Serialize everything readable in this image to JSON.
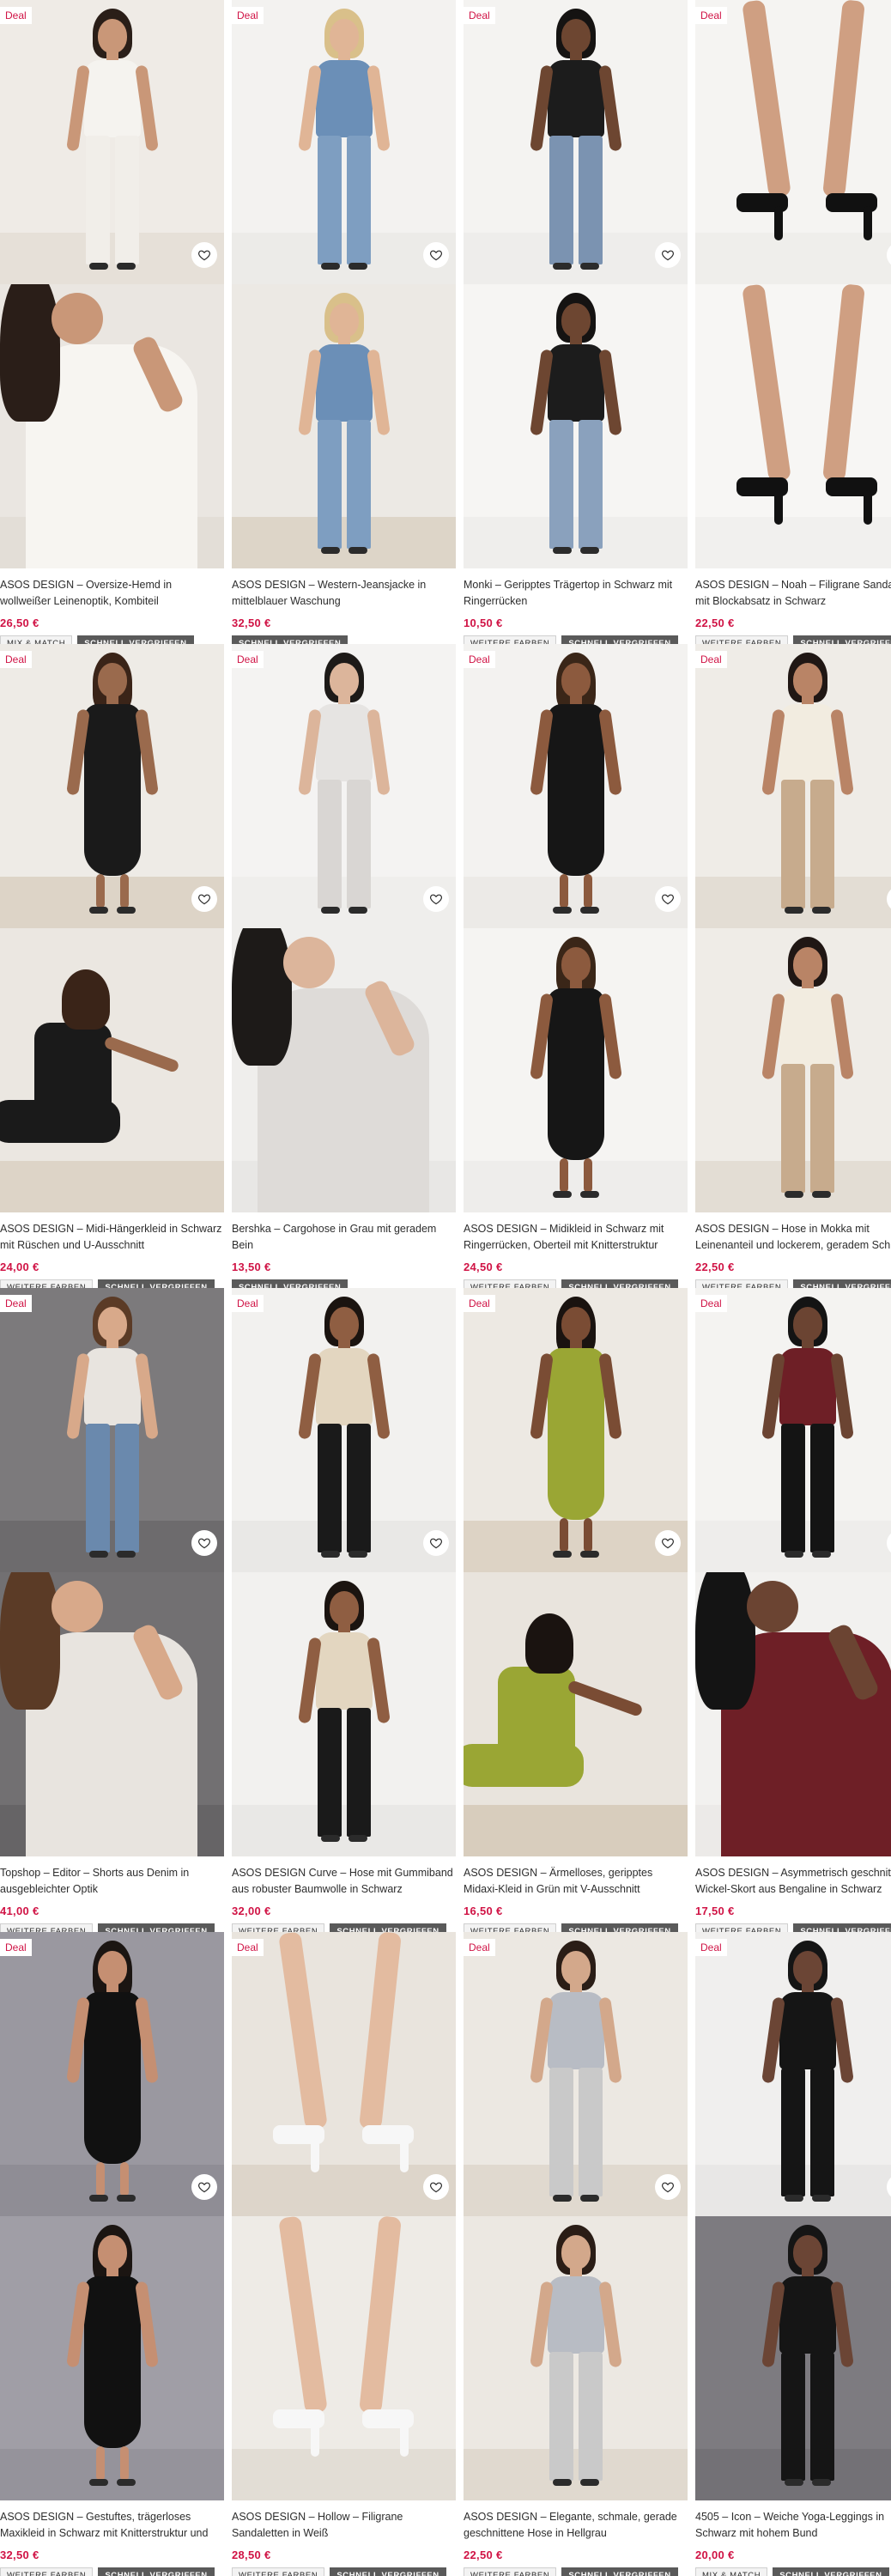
{
  "labels": {
    "deal": "Deal",
    "save_aria": "Speichern"
  },
  "products": [
    {
      "name": "ASOS DESIGN – Oversize-Hemd in wollweißer Leinenoptik, Kombiteil",
      "price": "26,50 €",
      "deal": true,
      "badges": [
        "MIX & MATCH",
        "SCHNELL VERGRIFFEN"
      ],
      "img": {
        "bg": "#efebe6",
        "floor": "#e6e0d8",
        "top": "#f5f3ef",
        "bottom": "#f1eee9",
        "hair": "#2a1e18",
        "skin": "#c99778",
        "scene": "person"
      },
      "img2": {
        "bg": "#eae6e1",
        "floor": "#e3ded7",
        "top": "#f7f5f1",
        "bottom": "#f7f5f1",
        "hair": "#2a1e18",
        "skin": "#c99778",
        "scene": "closeup"
      }
    },
    {
      "name": "ASOS DESIGN – Western-Jeansjacke in mittelblauer Waschung",
      "price": "32,50 €",
      "deal": true,
      "badges": [
        "SCHNELL VERGRIFFEN"
      ],
      "img": {
        "bg": "#f3f2f0",
        "floor": "#ecebe8",
        "top": "#6b8fb7",
        "bottom": "#7e9ec1",
        "hair": "#d9c08a",
        "skin": "#e0b596",
        "scene": "person"
      },
      "img2": {
        "bg": "#ece9e4",
        "floor": "#ddd5c8",
        "top": "#6b8fb7",
        "bottom": "#7e9ec1",
        "hair": "#d9c08a",
        "skin": "#e0b596",
        "scene": "person"
      }
    },
    {
      "name": "Monki – Geripptes Trägertop in Schwarz mit Ringerrücken",
      "price": "10,50 €",
      "deal": true,
      "badges": [
        "WEITERE FARBEN",
        "SCHNELL VERGRIFFEN"
      ],
      "img": {
        "bg": "#f4f3f1",
        "floor": "#eeedeb",
        "top": "#1c1c1c",
        "bottom": "#7b93b1",
        "hair": "#151312",
        "skin": "#6d4631",
        "scene": "person"
      },
      "img2": {
        "bg": "#f6f5f3",
        "floor": "#efeeec",
        "top": "#1c1c1c",
        "bottom": "#8aa1bd",
        "hair": "#151312",
        "skin": "#6d4631",
        "scene": "person"
      }
    },
    {
      "name": "ASOS DESIGN – Noah – Filigrane Sandalen mit Blockabsatz in Schwarz",
      "price": "22,50 €",
      "deal": true,
      "badges": [
        "WEITERE FARBEN",
        "SCHNELL VERGRIFFEN"
      ],
      "img": {
        "bg": "#f5f4f2",
        "floor": "#efeeeb",
        "top": "#d2a488",
        "bottom": "#111111",
        "hair": "#111111",
        "skin": "#cf9f82",
        "scene": "shoes"
      },
      "img2": {
        "bg": "#f7f6f4",
        "floor": "#f1f0ee",
        "top": "#d2a488",
        "bottom": "#111111",
        "hair": "#111111",
        "skin": "#cf9f82",
        "scene": "shoes"
      }
    },
    {
      "name": "ASOS DESIGN – Midi-Hängerkleid in Schwarz mit Rüschen und U-Ausschnitt",
      "price": "24,00 €",
      "deal": true,
      "badges": [
        "WEITERE FARBEN",
        "SCHNELL VERGRIFFEN"
      ],
      "img": {
        "bg": "#eeebe6",
        "floor": "#ddd4c7",
        "top": "#1a1a1a",
        "bottom": "#1a1a1a",
        "hair": "#3a2418",
        "skin": "#9a6a4d",
        "scene": "dress"
      },
      "img2": {
        "bg": "#ebe7e1",
        "floor": "#ddd4c7",
        "top": "#1a1a1a",
        "bottom": "#1a1a1a",
        "hair": "#3a2418",
        "skin": "#9a6a4d",
        "scene": "sitting"
      }
    },
    {
      "name": "Bershka – Cargohose in Grau mit geradem Bein",
      "price": "13,50 €",
      "deal": true,
      "badges": [
        "SCHNELL VERGRIFFEN"
      ],
      "img": {
        "bg": "#f4f3f2",
        "floor": "#efeeec",
        "top": "#e6e4e2",
        "bottom": "#d9d6d3",
        "hair": "#1d1a18",
        "skin": "#dcb59b",
        "scene": "person"
      },
      "img2": {
        "bg": "#efeeec",
        "floor": "#e8e7e5",
        "top": "#dedbd8",
        "bottom": "#d0ccc8",
        "hair": "#1d1a18",
        "skin": "#dcb59b",
        "scene": "closeup"
      }
    },
    {
      "name": "ASOS DESIGN – Midikleid in Schwarz mit Ringerrücken, Oberteil mit Knitterstruktur und...",
      "price": "24,50 €",
      "deal": true,
      "badges": [
        "WEITERE FARBEN",
        "SCHNELL VERGRIFFEN"
      ],
      "img": {
        "bg": "#f3f2f0",
        "floor": "#eceae7",
        "top": "#161616",
        "bottom": "#161616",
        "hair": "#3a2618",
        "skin": "#8c5a3e",
        "scene": "dress"
      },
      "img2": {
        "bg": "#f5f4f2",
        "floor": "#eeedeb",
        "top": "#161616",
        "bottom": "#161616",
        "hair": "#3a2618",
        "skin": "#8c5a3e",
        "scene": "dress"
      }
    },
    {
      "name": "ASOS DESIGN – Hose in Mokka mit Leinenanteil und lockerem, geradem Schnitt",
      "price": "22,50 €",
      "deal": true,
      "badges": [
        "WEITERE FARBEN",
        "SCHNELL VERGRIFFEN"
      ],
      "img": {
        "bg": "#efece7",
        "floor": "#e3ddd4",
        "top": "#f2ece0",
        "bottom": "#c7ab8d",
        "hair": "#201714",
        "skin": "#b98466",
        "scene": "person"
      },
      "img2": {
        "bg": "#efece7",
        "floor": "#e3ddd4",
        "top": "#f2ece0",
        "bottom": "#c7ab8d",
        "hair": "#201714",
        "skin": "#b98466",
        "scene": "person"
      }
    },
    {
      "name": "Topshop – Editor – Shorts aus Denim in ausgebleichter Optik",
      "price": "41,00 €",
      "deal": true,
      "badges": [
        "WEITERE FARBEN",
        "SCHNELL VERGRIFFEN"
      ],
      "img": {
        "bg": "#7c7a7c",
        "floor": "#6d6b6d",
        "top": "#e8e4df",
        "bottom": "#6a89ad",
        "hair": "#5b3b26",
        "skin": "#d8a98a",
        "scene": "person"
      },
      "img2": {
        "bg": "#727072",
        "floor": "#666466",
        "top": "#e8e4df",
        "bottom": "#6a89ad",
        "hair": "#5b3b26",
        "skin": "#d8a98a",
        "scene": "closeup"
      }
    },
    {
      "name": "ASOS DESIGN Curve – Hose mit Gummiband aus robuster Baumwolle in Schwarz",
      "price": "32,00 €",
      "deal": true,
      "badges": [
        "WEITERE FARBEN",
        "SCHNELL VERGRIFFEN"
      ],
      "img": {
        "bg": "#f2f1ef",
        "floor": "#e9e8e6",
        "top": "#e3d6c0",
        "bottom": "#1a1a1a",
        "hair": "#1b1410",
        "skin": "#8f5e42",
        "scene": "person"
      },
      "img2": {
        "bg": "#f2f1ef",
        "floor": "#e9e8e6",
        "top": "#e3d6c0",
        "bottom": "#1a1a1a",
        "hair": "#1b1410",
        "skin": "#8f5e42",
        "scene": "person"
      }
    },
    {
      "name": "ASOS DESIGN – Ärmelloses, geripptes Midaxi-Kleid in Grün mit V-Ausschnitt",
      "price": "16,50 €",
      "deal": true,
      "badges": [
        "WEITERE FARBEN",
        "SCHNELL VERGRIFFEN"
      ],
      "img": {
        "bg": "#ede9e3",
        "floor": "#ddd3c5",
        "top": "#9aa634",
        "bottom": "#9aa634",
        "hair": "#1a1310",
        "skin": "#7a4c34",
        "scene": "dress"
      },
      "img2": {
        "bg": "#e9e4dd",
        "floor": "#d8cdbd",
        "top": "#9aa634",
        "bottom": "#9aa634",
        "hair": "#1a1310",
        "skin": "#7a4c34",
        "scene": "sitting"
      }
    },
    {
      "name": "ASOS DESIGN – Asymmetrisch geschnittener Wickel-Skort aus Bengaline in Schwarz",
      "price": "17,50 €",
      "deal": true,
      "badges": [
        "WEITERE FARBEN",
        "SCHNELL VERGRIFFEN"
      ],
      "img": {
        "bg": "#f4f3f1",
        "floor": "#eeedeb",
        "top": "#6e1f26",
        "bottom": "#141414",
        "hair": "#141414",
        "skin": "#6b4432",
        "scene": "person"
      },
      "img2": {
        "bg": "#f2f1ef",
        "floor": "#eceae8",
        "top": "#6e1f26",
        "bottom": "#141414",
        "hair": "#141414",
        "skin": "#6b4432",
        "scene": "closeup"
      }
    },
    {
      "name": "ASOS DESIGN – Gestuftes, trägerloses Maxikleid in Schwarz mit Knitterstruktur und gesmoktem Oberteil",
      "price": "32,50 €",
      "deal": true,
      "badges": [
        "WEITERE FARBEN",
        "SCHNELL VERGRIFFEN"
      ],
      "img": {
        "bg": "#9a98a0",
        "floor": "#8f8d95",
        "top": "#111111",
        "bottom": "#111111",
        "hair": "#1b1512",
        "skin": "#c58f72",
        "scene": "dress"
      },
      "img2": {
        "bg": "#a09ea6",
        "floor": "#95939b",
        "top": "#111111",
        "bottom": "#111111",
        "hair": "#1b1512",
        "skin": "#c58f72",
        "scene": "dress"
      }
    },
    {
      "name": "ASOS DESIGN – Hollow – Filigrane Sandaletten in Weiß",
      "price": "28,50 €",
      "deal": true,
      "badges": [
        "WEITERE FARBEN",
        "SCHNELL VERGRIFFEN"
      ],
      "img": {
        "bg": "#e9e4dd",
        "floor": "#ddd5ca",
        "top": "#8fa9c6",
        "bottom": "#f7f7f7",
        "hair": "#111111",
        "skin": "#e3bba0",
        "scene": "shoes"
      },
      "img2": {
        "bg": "#eeebe6",
        "floor": "#e2ddd5",
        "top": "#8fa9c6",
        "bottom": "#f7f7f7",
        "hair": "#111111",
        "skin": "#e3bba0",
        "scene": "shoes"
      }
    },
    {
      "name": "ASOS DESIGN – Elegante, schmale, gerade geschnittene Hose in Hellgrau",
      "price": "22,50 €",
      "deal": true,
      "badges": [
        "WEITERE FARBEN",
        "SCHNELL VERGRIFFEN"
      ],
      "img": {
        "bg": "#ece8e2",
        "floor": "#e0d9cf",
        "top": "#b8bcc4",
        "bottom": "#c9c9c9",
        "hair": "#2a1d16",
        "skin": "#d3a88b",
        "scene": "person"
      },
      "img2": {
        "bg": "#ece8e2",
        "floor": "#e0d9cf",
        "top": "#b8bcc4",
        "bottom": "#c9c9c9",
        "hair": "#2a1d16",
        "skin": "#d3a88b",
        "scene": "person"
      }
    },
    {
      "name": "4505 – Icon – Weiche Yoga-Leggings in Schwarz mit hohem Bund",
      "price": "20,00 €",
      "deal": true,
      "badges": [
        "MIX & MATCH",
        "SCHNELL VERGRIFFEN"
      ],
      "img": {
        "bg": "#f0efee",
        "floor": "#e8e7e6",
        "top": "#151515",
        "bottom": "#151515",
        "hair": "#151515",
        "skin": "#6b4535",
        "scene": "person"
      },
      "img2": {
        "bg": "#7d7b80",
        "floor": "#737176",
        "top": "#151515",
        "bottom": "#151515",
        "hair": "#151515",
        "skin": "#6b4535",
        "scene": "person"
      }
    }
  ]
}
